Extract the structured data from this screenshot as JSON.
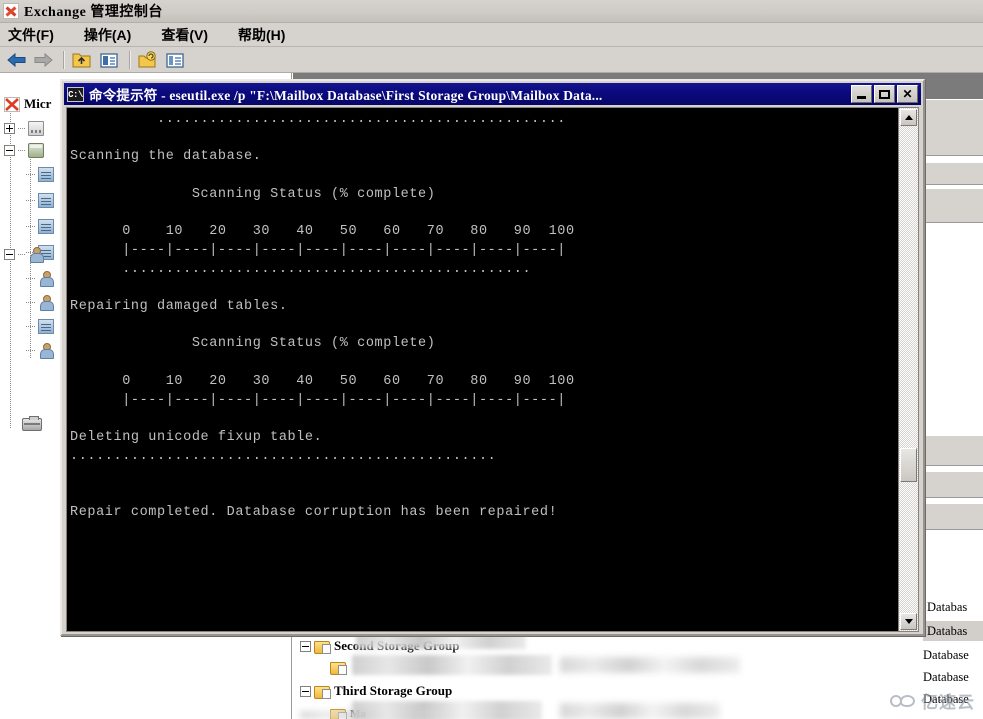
{
  "window": {
    "title": "Exchange 管理控制台",
    "app_icon": "exchange-logo-icon"
  },
  "menu": {
    "items": [
      {
        "label": "文件(F)"
      },
      {
        "label": "操作(A)"
      },
      {
        "label": "查看(V)"
      },
      {
        "label": "帮助(H)"
      }
    ]
  },
  "toolbar": {
    "back_icon": "back-arrow-icon",
    "forward_icon": "forward-arrow-icon",
    "buttons": [
      {
        "icon": "up-folder-icon"
      },
      {
        "icon": "properties-icon"
      },
      {
        "icon": "refresh-folder-icon"
      },
      {
        "icon": "show-pane-icon"
      }
    ]
  },
  "tree": {
    "root_label": "Micr",
    "nodes": [
      {
        "label": "Second Storage Group",
        "expander": "minus",
        "icon": "storage-group-folder-icon"
      },
      {
        "label": "Third Storage Group",
        "expander": "minus",
        "icon": "storage-group-folder-icon"
      },
      {
        "label": "Ma",
        "expander": "none",
        "icon": "mailbox-database-icon"
      }
    ]
  },
  "list": {
    "rows": [
      {
        "label": "Databas",
        "selected": false
      },
      {
        "label": "Databas",
        "selected": true
      },
      {
        "label": "Database",
        "selected": false
      },
      {
        "label": "Database",
        "selected": false
      },
      {
        "label": "Database",
        "selected": false
      }
    ]
  },
  "cmd": {
    "title": "命令提示符 - eseutil.exe /p \"F:\\Mailbox Database\\First Storage Group\\Mailbox Data...",
    "icon_label": "C:\\",
    "minimize_label": "",
    "maximize_label": "",
    "close_label": "✕",
    "scrollbar": {
      "up_arrow": "scroll-up-arrow-icon",
      "down_arrow": "scroll-down-arrow-icon",
      "thumb_position_percent": 70
    },
    "output": "          ...............................................\n\nScanning the database.\n\n              Scanning Status (% complete)\n\n      0    10   20   30   40   50   60   70   80   90  100\n      |----|----|----|----|----|----|----|----|----|----|\n      ...............................................\n\nRepairing damaged tables.\n\n              Scanning Status (% complete)\n\n      0    10   20   30   40   50   60   70   80   90  100\n      |----|----|----|----|----|----|----|----|----|----|\n\nDeleting unicode fixup table.\n.................................................\n\n\nRepair completed. Database corruption has been repaired!"
  },
  "watermark": {
    "text": "亿速云",
    "icon": "cloud-icon"
  }
}
